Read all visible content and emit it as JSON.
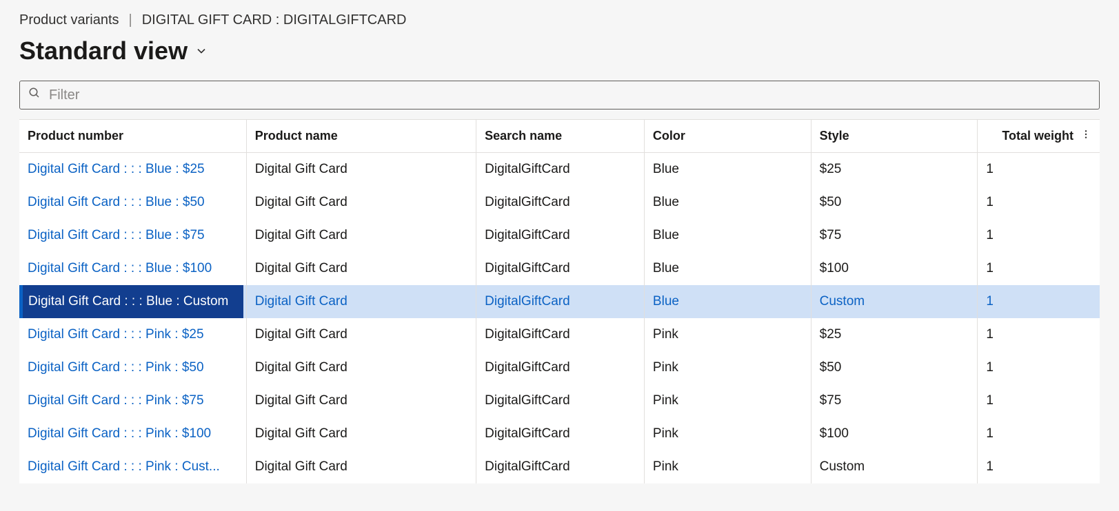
{
  "breadcrumb": {
    "section": "Product variants",
    "current": "DIGITAL GIFT CARD : DIGITALGIFTCARD"
  },
  "view_title": "Standard view",
  "filter": {
    "placeholder": "Filter",
    "value": ""
  },
  "columns": {
    "product_number": "Product number",
    "product_name": "Product name",
    "search_name": "Search name",
    "color": "Color",
    "style": "Style",
    "total_weight": "Total weight"
  },
  "selected_index": 4,
  "rows": [
    {
      "product_number": "Digital Gift Card :  :  : Blue : $25",
      "product_name": "Digital Gift Card",
      "search_name": "DigitalGiftCard",
      "color": "Blue",
      "style": "$25",
      "total_weight": "1"
    },
    {
      "product_number": "Digital Gift Card :  :  : Blue : $50",
      "product_name": "Digital Gift Card",
      "search_name": "DigitalGiftCard",
      "color": "Blue",
      "style": "$50",
      "total_weight": "1"
    },
    {
      "product_number": "Digital Gift Card :  :  : Blue : $75",
      "product_name": "Digital Gift Card",
      "search_name": "DigitalGiftCard",
      "color": "Blue",
      "style": "$75",
      "total_weight": "1"
    },
    {
      "product_number": "Digital Gift Card :  :  : Blue : $100",
      "product_name": "Digital Gift Card",
      "search_name": "DigitalGiftCard",
      "color": "Blue",
      "style": "$100",
      "total_weight": "1"
    },
    {
      "product_number": "Digital Gift Card :  :  : Blue : Custom",
      "product_name": "Digital Gift Card",
      "search_name": "DigitalGiftCard",
      "color": "Blue",
      "style": "Custom",
      "total_weight": "1"
    },
    {
      "product_number": "Digital Gift Card :  :  : Pink : $25",
      "product_name": "Digital Gift Card",
      "search_name": "DigitalGiftCard",
      "color": "Pink",
      "style": "$25",
      "total_weight": "1"
    },
    {
      "product_number": "Digital Gift Card :  :  : Pink : $50",
      "product_name": "Digital Gift Card",
      "search_name": "DigitalGiftCard",
      "color": "Pink",
      "style": "$50",
      "total_weight": "1"
    },
    {
      "product_number": "Digital Gift Card :  :  : Pink : $75",
      "product_name": "Digital Gift Card",
      "search_name": "DigitalGiftCard",
      "color": "Pink",
      "style": "$75",
      "total_weight": "1"
    },
    {
      "product_number": "Digital Gift Card :  :  : Pink : $100",
      "product_name": "Digital Gift Card",
      "search_name": "DigitalGiftCard",
      "color": "Pink",
      "style": "$100",
      "total_weight": "1"
    },
    {
      "product_number": "Digital Gift Card :  :  : Pink : Custom",
      "product_name": "Digital Gift Card",
      "search_name": "DigitalGiftCard",
      "color": "Pink",
      "style": "Custom",
      "total_weight": "1",
      "truncate_hint": "Digital Gift Card :  :  : Pink : Cust..."
    }
  ]
}
